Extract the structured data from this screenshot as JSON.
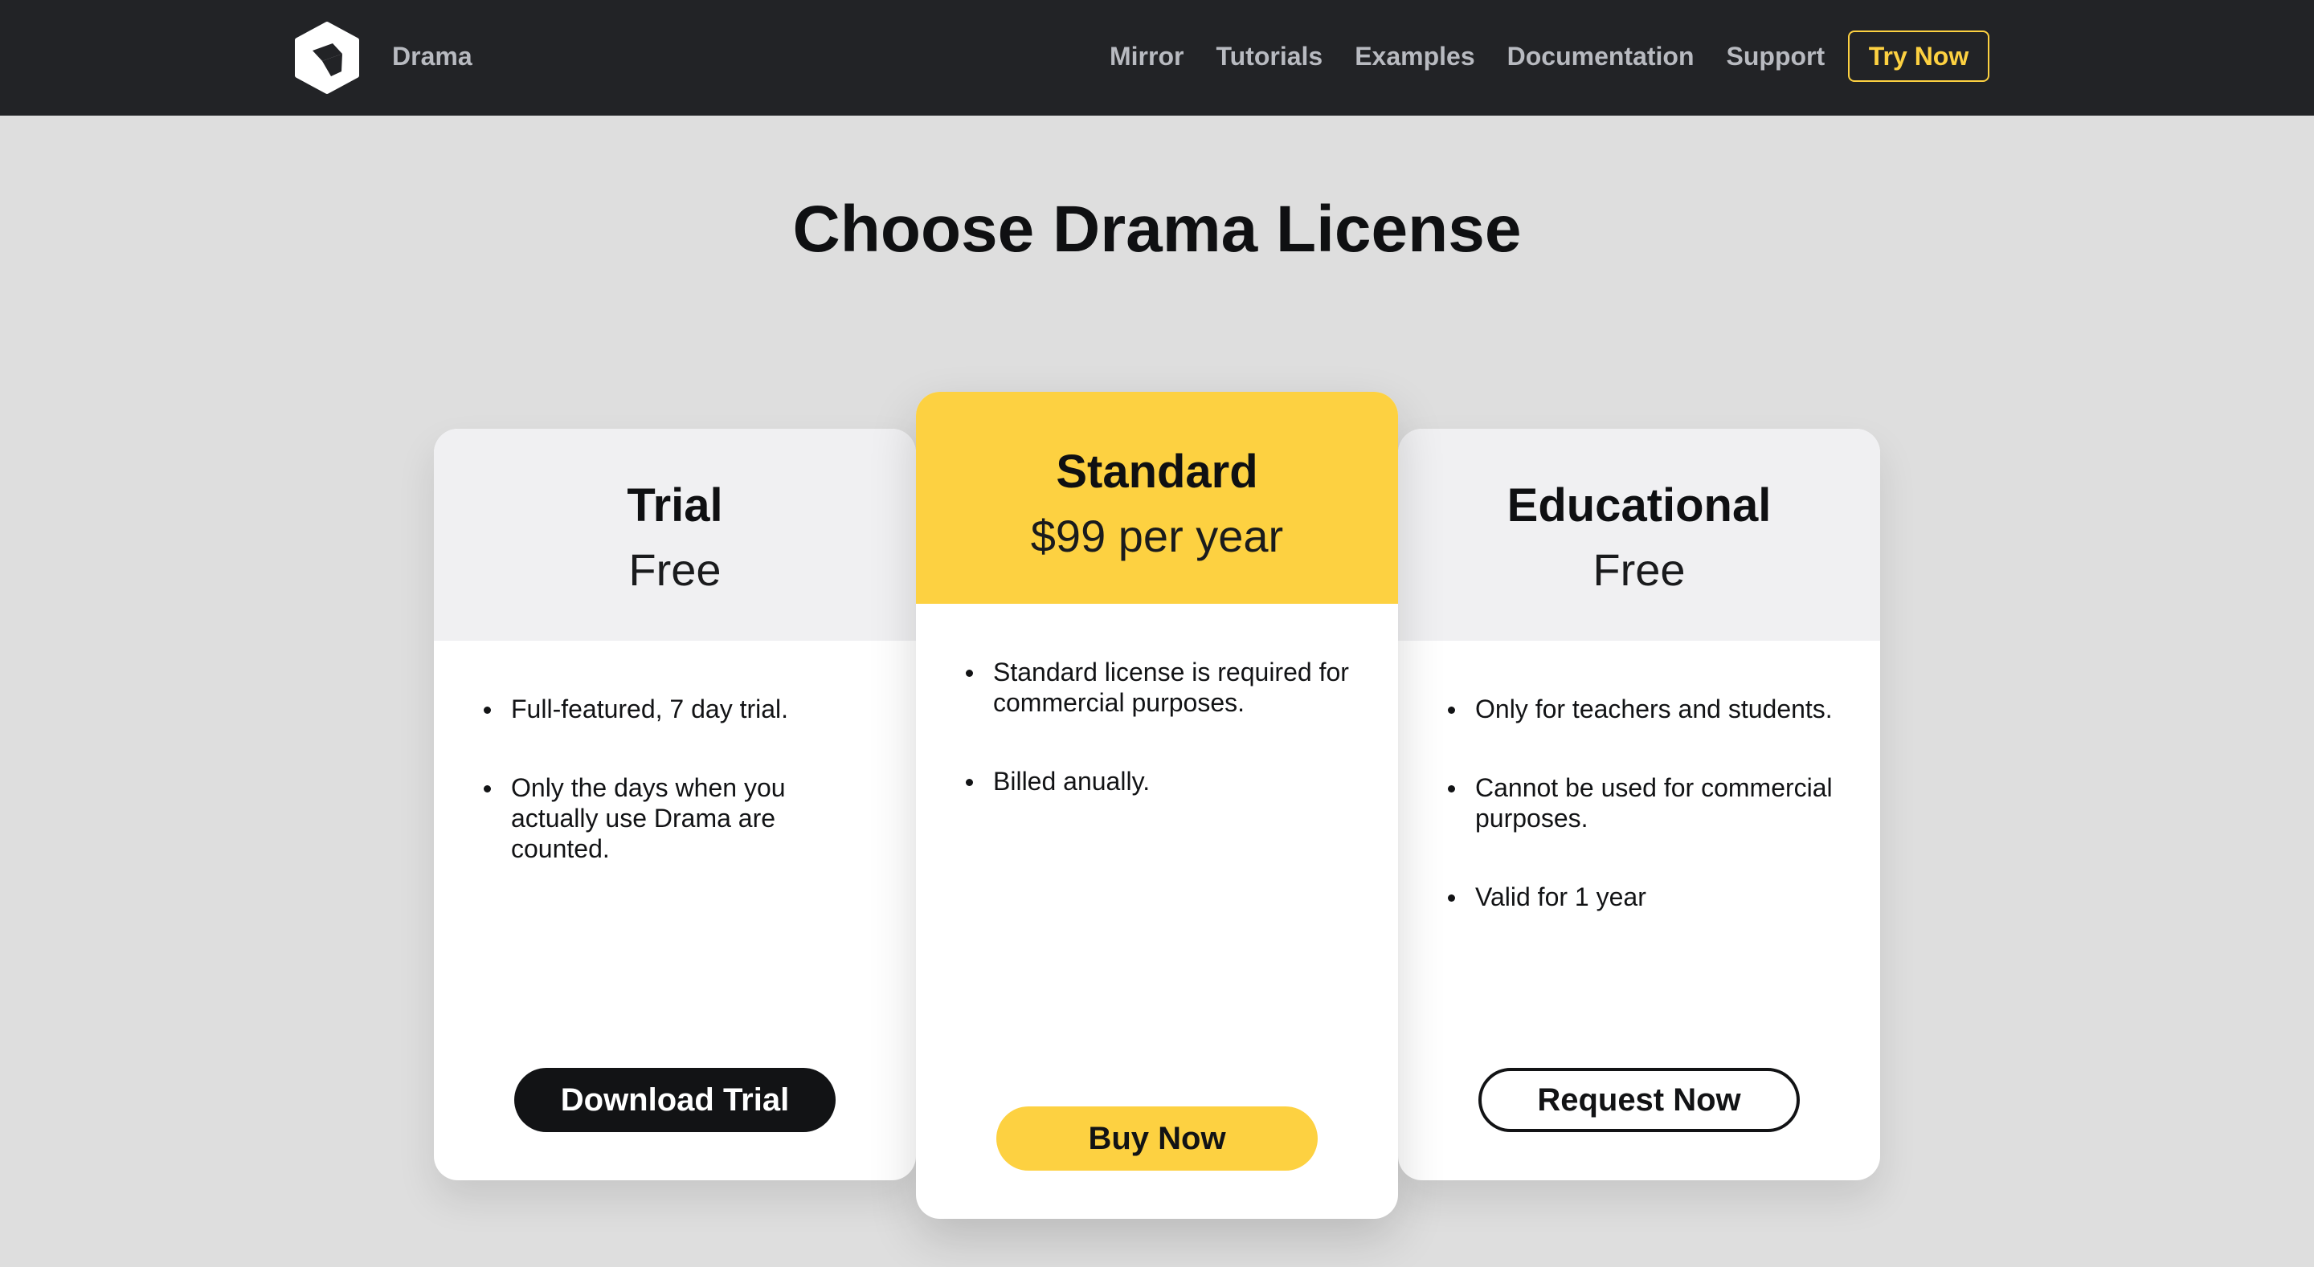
{
  "header": {
    "brand": "Drama",
    "nav": [
      "Mirror",
      "Tutorials",
      "Examples",
      "Documentation",
      "Support"
    ],
    "cta": "Try Now",
    "logo_icon": "cube-icon"
  },
  "page": {
    "title": "Choose Drama License"
  },
  "plans": [
    {
      "name": "Trial",
      "price": "Free",
      "features": [
        "Full-featured, 7 day trial.",
        "Only the days when you actually use Drama are counted."
      ],
      "button": "Download Trial"
    },
    {
      "name": "Standard",
      "price": "$99 per year",
      "features": [
        "Standard license is required for commercial purposes.",
        "Billed anually."
      ],
      "button": "Buy Now"
    },
    {
      "name": "Educational",
      "price": "Free",
      "features": [
        "Only for teachers and students.",
        "Cannot be used for commercial purposes.",
        "Valid for 1 year"
      ],
      "button": "Request Now"
    }
  ],
  "colors": {
    "accent": "#fdd141",
    "header_bg": "#222326",
    "page_bg": "#dedede",
    "dark": "#121315"
  }
}
